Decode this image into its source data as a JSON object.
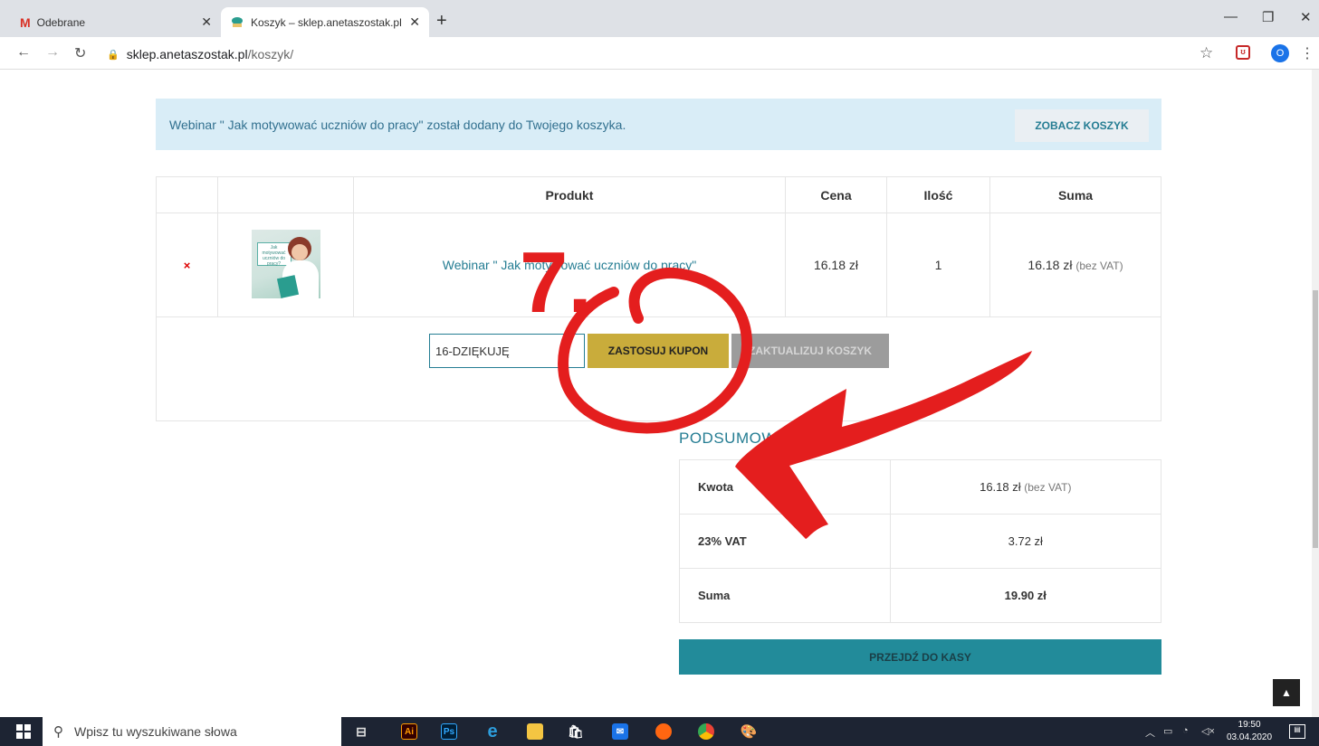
{
  "browser": {
    "tabs": [
      {
        "title": "Odebrane",
        "favicon": "gmail-icon"
      },
      {
        "title": "Koszyk – sklep.anetaszostak.pl",
        "favicon": "site-icon"
      }
    ],
    "url_domain": "sklep.anetaszostak.pl",
    "url_path": "/koszyk/",
    "profile_initial": "O"
  },
  "notice": {
    "message": "Webinar \" Jak motywować uczniów do pracy\" został dodany do Twojego koszyka.",
    "button": "ZOBACZ KOSZYK"
  },
  "cart": {
    "headers": [
      "Produkt",
      "Cena",
      "Ilość",
      "Suma"
    ],
    "rows": [
      {
        "remove": "×",
        "product": "Webinar \" Jak motywować uczniów do pracy\"",
        "price": "16.18 zł",
        "qty": "1",
        "total": "16.18 zł",
        "total_note": "(bez VAT)",
        "thumb_card_title": "Jak motywować uczniów do pracy?"
      }
    ],
    "coupon_value": "16-DZIĘKUJĘ",
    "apply_label": "ZASTOSUJ KUPON",
    "update_label": "ZAKTUALIZUJ KOSZYK"
  },
  "totals": {
    "title": "PODSUMOWANIE",
    "rows": [
      {
        "label": "Kwota",
        "value": "16.18 zł",
        "note": "(bez VAT)"
      },
      {
        "label": "23% VAT",
        "value": "3.72 zł"
      },
      {
        "label": "Suma",
        "value": "19.90 zł"
      }
    ],
    "checkout_label": "PRZEJDŹ DO KASY"
  },
  "annotation": {
    "number": "7.",
    "color": "#e41e1e"
  },
  "taskbar": {
    "search_placeholder": "Wpisz tu wyszukiwane słowa",
    "time": "19:50",
    "date": "03.04.2020"
  }
}
